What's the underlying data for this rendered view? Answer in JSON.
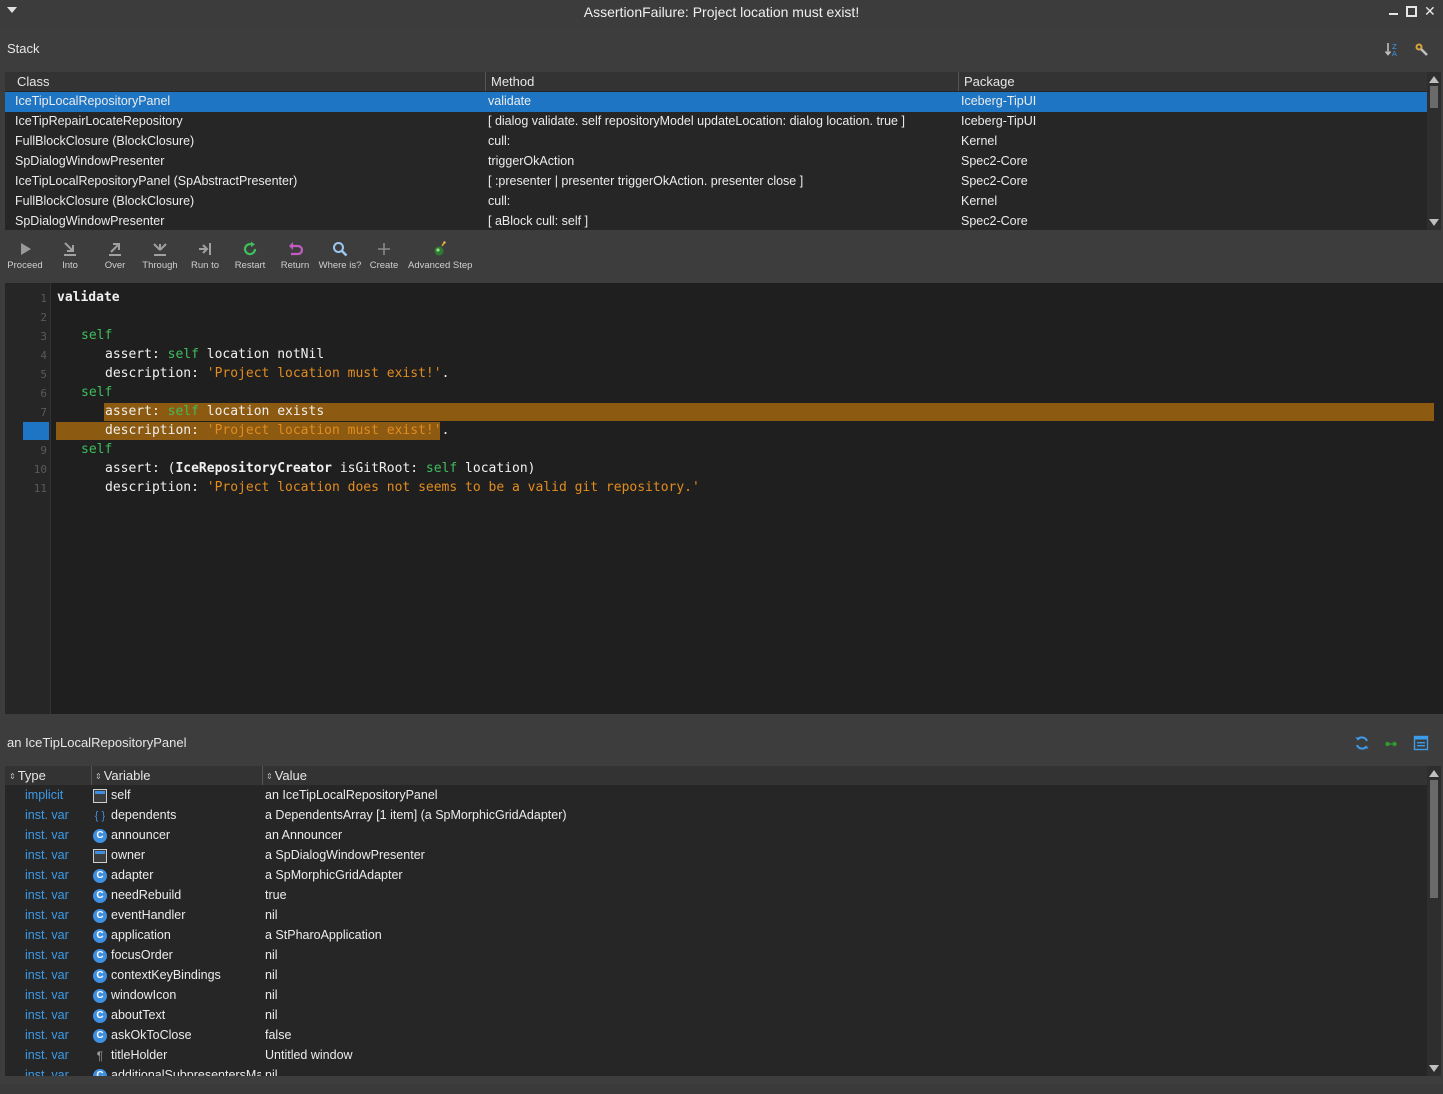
{
  "window": {
    "title": "AssertionFailure: Project location must exist!",
    "close_glyph": "✕"
  },
  "stack": {
    "label": "Stack",
    "columns": [
      "Class",
      "Method",
      "Package"
    ],
    "rows": [
      {
        "class": "IceTipLocalRepositoryPanel",
        "method": "validate",
        "package": "Iceberg-TipUI"
      },
      {
        "class": "IceTipRepairLocateRepository",
        "method": "[    dialog validate.    self repositoryModel updateLocation: dialog location.    true ]",
        "package": "Iceberg-TipUI"
      },
      {
        "class": "FullBlockClosure (BlockClosure)",
        "method": "cull:",
        "package": "Kernel"
      },
      {
        "class": "SpDialogWindowPresenter",
        "method": "triggerOkAction",
        "package": "Spec2-Core"
      },
      {
        "class": "IceTipLocalRepositoryPanel (SpAbstractPresenter)",
        "method": "[ :presenter |     presenter triggerOkAction.    presenter close ]",
        "package": "Spec2-Core"
      },
      {
        "class": "FullBlockClosure (BlockClosure)",
        "method": "cull:",
        "package": "Kernel"
      },
      {
        "class": "SpDialogWindowPresenter",
        "method": "[ aBlock cull: self ]",
        "package": "Spec2-Core"
      }
    ]
  },
  "toolbar": {
    "buttons": [
      {
        "label": "Proceed",
        "icon": "proceed-icon"
      },
      {
        "label": "Into",
        "icon": "step-into-icon"
      },
      {
        "label": "Over",
        "icon": "step-over-icon"
      },
      {
        "label": "Through",
        "icon": "step-through-icon"
      },
      {
        "label": "Run to",
        "icon": "run-to-icon"
      },
      {
        "label": "Restart",
        "icon": "restart-icon"
      },
      {
        "label": "Return",
        "icon": "return-icon"
      },
      {
        "label": "Where is?",
        "icon": "where-is-icon"
      },
      {
        "label": "Create",
        "icon": "create-icon"
      },
      {
        "label": "Advanced Step",
        "icon": "advanced-step-icon"
      }
    ]
  },
  "editor": {
    "line_numbers": [
      "1",
      "2",
      "3",
      "4",
      "5",
      "6",
      "7",
      "8",
      "9",
      "10",
      "11"
    ],
    "current_line": "8",
    "code": {
      "l1": "validate",
      "l3_kw": "self",
      "l4_a": "assert: ",
      "l4_kw": "self",
      "l4_b": " location notNil",
      "l5_a": "description: ",
      "l5_str": "'Project location must exist!'",
      "l5_b": ".",
      "l6_kw": "self",
      "l7_a": "assert: ",
      "l7_kw": "self",
      "l7_b": " location exists",
      "l8_a": "description: ",
      "l8_str": "'Project location must exist!'",
      "l8_b": ".",
      "l9_kw": "self",
      "l10_a": "assert: (",
      "l10_bold": "IceRepositoryCreator",
      "l10_b": " isGitRoot: ",
      "l10_kw": "self",
      "l10_c": " location)",
      "l11_a": "description: ",
      "l11_str": "'Project location does not seems to be a valid git repository.'"
    }
  },
  "inspector": {
    "label": "an IceTipLocalRepositoryPanel",
    "columns": [
      "Type",
      "Variable",
      "Value"
    ],
    "rows": [
      {
        "type": "implicit",
        "icon": "window-icon",
        "variable": "self",
        "value": "an IceTipLocalRepositoryPanel"
      },
      {
        "type": "inst. var",
        "icon": "braces-icon",
        "variable": "dependents",
        "value": "a DependentsArray [1 item] (a SpMorphicGridAdapter)"
      },
      {
        "type": "inst. var",
        "icon": "class-icon",
        "variable": "announcer",
        "value": "an Announcer"
      },
      {
        "type": "inst. var",
        "icon": "window-icon",
        "variable": "owner",
        "value": "a SpDialogWindowPresenter"
      },
      {
        "type": "inst. var",
        "icon": "class-icon",
        "variable": "adapter",
        "value": "a SpMorphicGridAdapter"
      },
      {
        "type": "inst. var",
        "icon": "class-icon",
        "variable": "needRebuild",
        "value": "true"
      },
      {
        "type": "inst. var",
        "icon": "class-icon",
        "variable": "eventHandler",
        "value": "nil"
      },
      {
        "type": "inst. var",
        "icon": "class-icon",
        "variable": "application",
        "value": "a StPharoApplication"
      },
      {
        "type": "inst. var",
        "icon": "class-icon",
        "variable": "focusOrder",
        "value": "nil"
      },
      {
        "type": "inst. var",
        "icon": "class-icon",
        "variable": "contextKeyBindings",
        "value": "nil"
      },
      {
        "type": "inst. var",
        "icon": "class-icon",
        "variable": "windowIcon",
        "value": "nil"
      },
      {
        "type": "inst. var",
        "icon": "class-icon",
        "variable": "aboutText",
        "value": "nil"
      },
      {
        "type": "inst. var",
        "icon": "class-icon",
        "variable": "askOkToClose",
        "value": "false"
      },
      {
        "type": "inst. var",
        "icon": "paragraph-icon",
        "variable": "titleHolder",
        "value": "Untitled window"
      },
      {
        "type": "inst. var",
        "icon": "class-icon",
        "variable": "additionalSubpresentersMap",
        "value": "nil"
      }
    ]
  },
  "colors": {
    "selection": "#1e75c4",
    "keyword": "#3fbe5c",
    "string": "#e28c1f",
    "highlight": "#8c5a10",
    "type_text": "#3d9be9"
  }
}
